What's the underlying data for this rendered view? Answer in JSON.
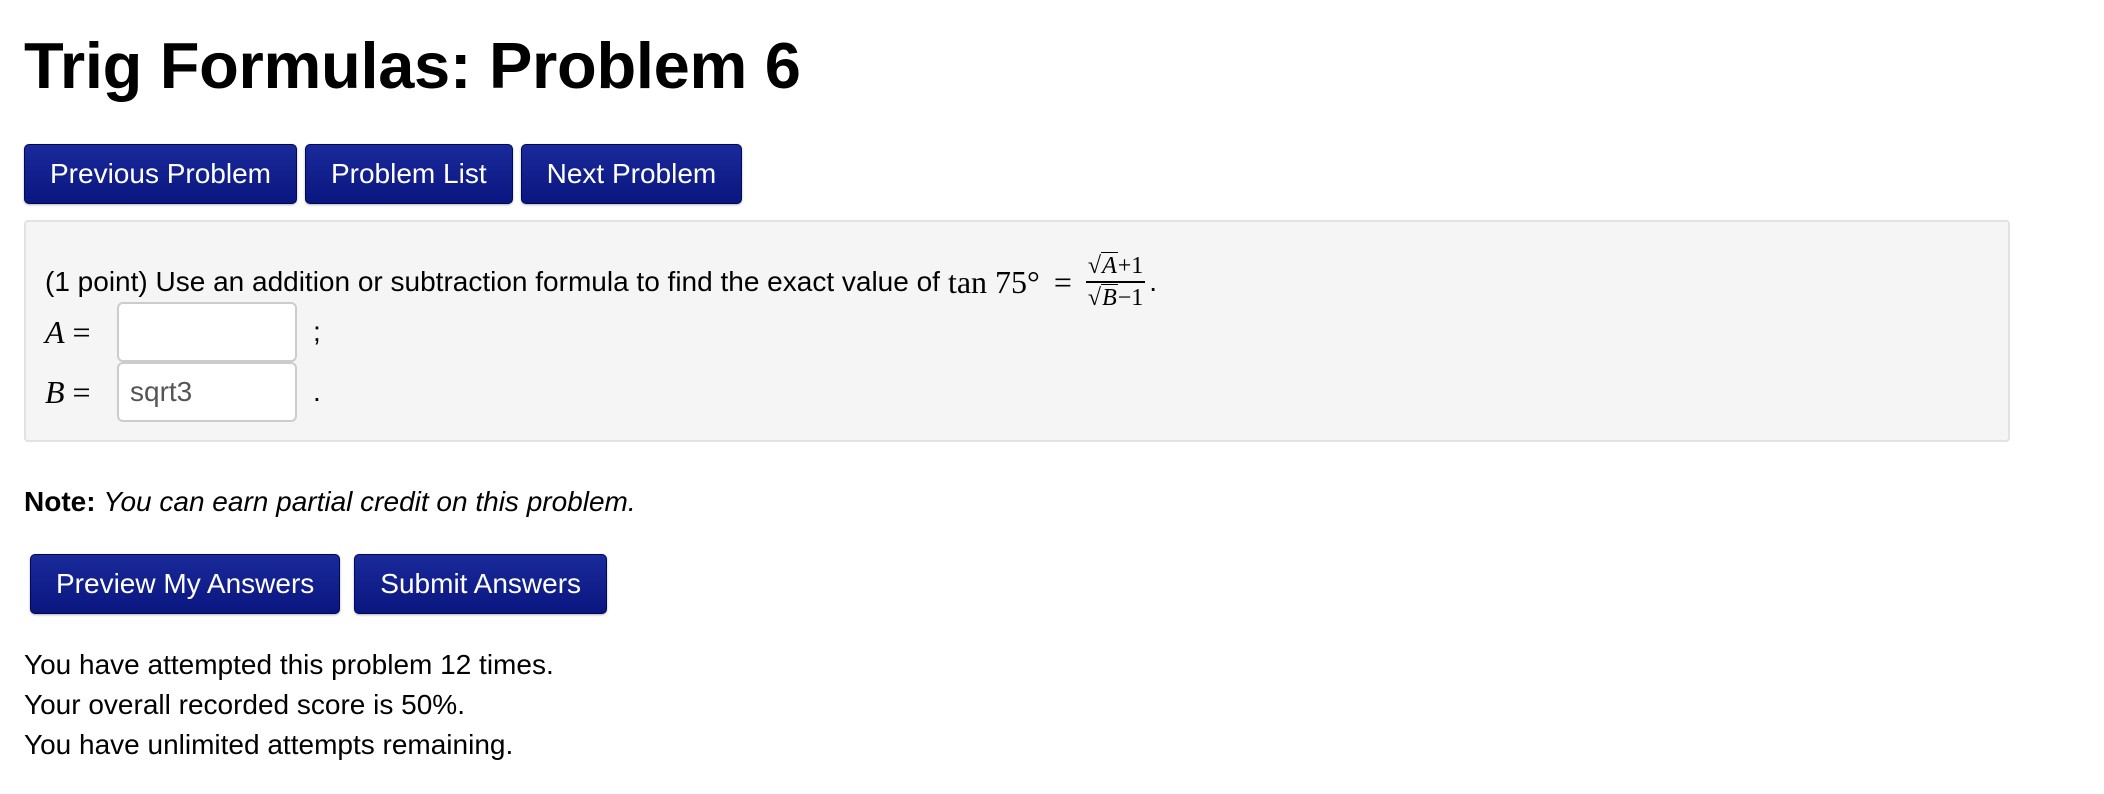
{
  "page": {
    "title": "Trig Formulas: Problem 6"
  },
  "nav": {
    "previous_label": "Previous Problem",
    "list_label": "Problem List",
    "next_label": "Next Problem"
  },
  "problem": {
    "points": "(1 point)",
    "text": "Use an addition or subtraction formula to find the exact value of",
    "func": "tan 75°",
    "equals": "=",
    "numerator_var": "A",
    "numerator_rest": "+1",
    "denominator_var": "B",
    "denominator_rest": "−1",
    "end_period": "."
  },
  "answers": [
    {
      "var": "A",
      "equals": "=",
      "value": "",
      "separator": ";"
    },
    {
      "var": "B",
      "equals": "=",
      "value": "sqrt3",
      "separator": "."
    }
  ],
  "note": {
    "label": "Note:",
    "text": "You can earn partial credit on this problem."
  },
  "actions": {
    "preview_label": "Preview My Answers",
    "submit_label": "Submit Answers"
  },
  "status": {
    "attempts": "You have attempted this problem 12 times.",
    "score": "Your overall recorded score is 50%.",
    "remaining": "You have unlimited attempts remaining."
  },
  "colors": {
    "button_bg": "#0d1a8a",
    "problem_bg": "#f5f5f5"
  }
}
